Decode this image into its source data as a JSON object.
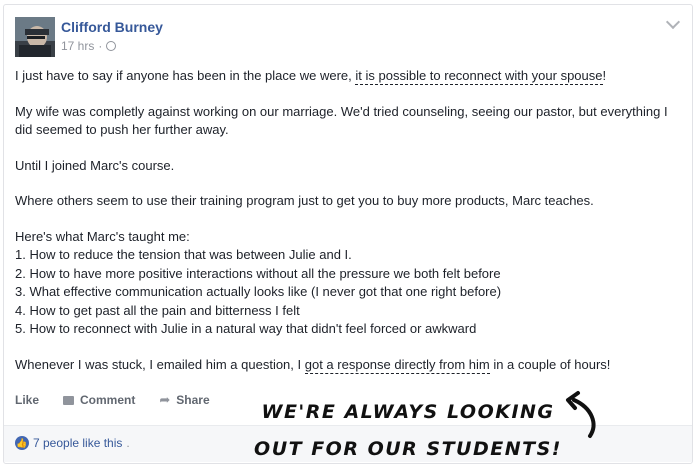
{
  "post": {
    "author": "Clifford Burney",
    "timestamp": "17 hrs",
    "meta_sep": "·",
    "intro_before": "I just have to say if anyone has been in the place we were, ",
    "intro_underlined": "it is possible to reconnect with your spouse",
    "intro_after": "!",
    "paragraph_2": "My wife was completly against working on our marriage. We'd tried counseling, seeing our pastor, but everything I did seemed to push her further away.",
    "paragraph_3": "Until I joined Marc's course.",
    "paragraph_4": "Where others seem to use their training program just to get you to buy more products, Marc teaches.",
    "list_intro": "Here's what Marc's taught me:",
    "list_items": [
      "1. How to reduce the tension that was between Julie and I.",
      "2. How to have more positive interactions without all the pressure we both felt before",
      "3. What effective communication actually looks like (I never got that one right before)",
      "4. How to get past all the pain and bitterness I felt",
      "5. How to reconnect with Julie in a natural way that didn't feel forced or awkward"
    ],
    "closing_before": "Whenever I was stuck, I emailed him a question, I ",
    "closing_underlined": "got a response directly from him",
    "closing_after": " in a couple of hours!"
  },
  "actions": {
    "like": "Like",
    "comment": "Comment",
    "share": "Share"
  },
  "likes": {
    "text": "7 people like this",
    "suffix": "."
  },
  "overlay": {
    "line_1": "We're always looking",
    "line_2": "out for our students!"
  },
  "colors": {
    "link_blue": "#365899",
    "text": "#1d2129",
    "muted": "#90949c"
  }
}
